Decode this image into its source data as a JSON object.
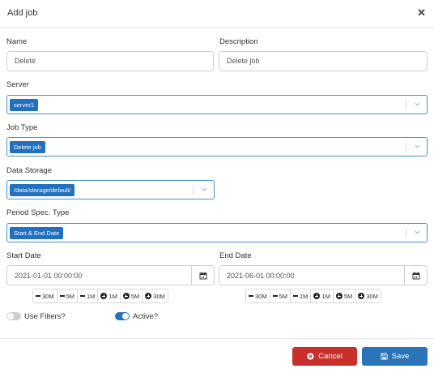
{
  "modal": {
    "title": "Add job"
  },
  "form": {
    "name": {
      "label": "Name",
      "value": "Delete"
    },
    "description": {
      "label": "Description",
      "value": "Delete job"
    },
    "server": {
      "label": "Server",
      "tag": "server1"
    },
    "job_type": {
      "label": "Job Type",
      "tag": "Delete job"
    },
    "data_storage": {
      "label": "Data Storage",
      "tag": "/data/storage/default/"
    },
    "period_spec": {
      "label": "Period Spec. Type",
      "tag": "Start & End Date"
    },
    "start_date": {
      "label": "Start Date",
      "value": "2021-01-01 00:00:00"
    },
    "end_date": {
      "label": "End Date",
      "value": "2021-06-01 00:00:00"
    },
    "steps": [
      "30M",
      "5M",
      "1M",
      "1M",
      "5M",
      "30M"
    ],
    "use_filters": {
      "label": "Use Filters?",
      "on": false
    },
    "active": {
      "label": "Active?",
      "on": true
    }
  },
  "footer": {
    "cancel_label": "Cancel",
    "save_label": "Save"
  },
  "colors": {
    "tag": "#2270c0",
    "cancel": "#c9302c",
    "save": "#2a74b8",
    "toggle_on": "#2270c0",
    "toggle_off": "#cfcfcf"
  }
}
